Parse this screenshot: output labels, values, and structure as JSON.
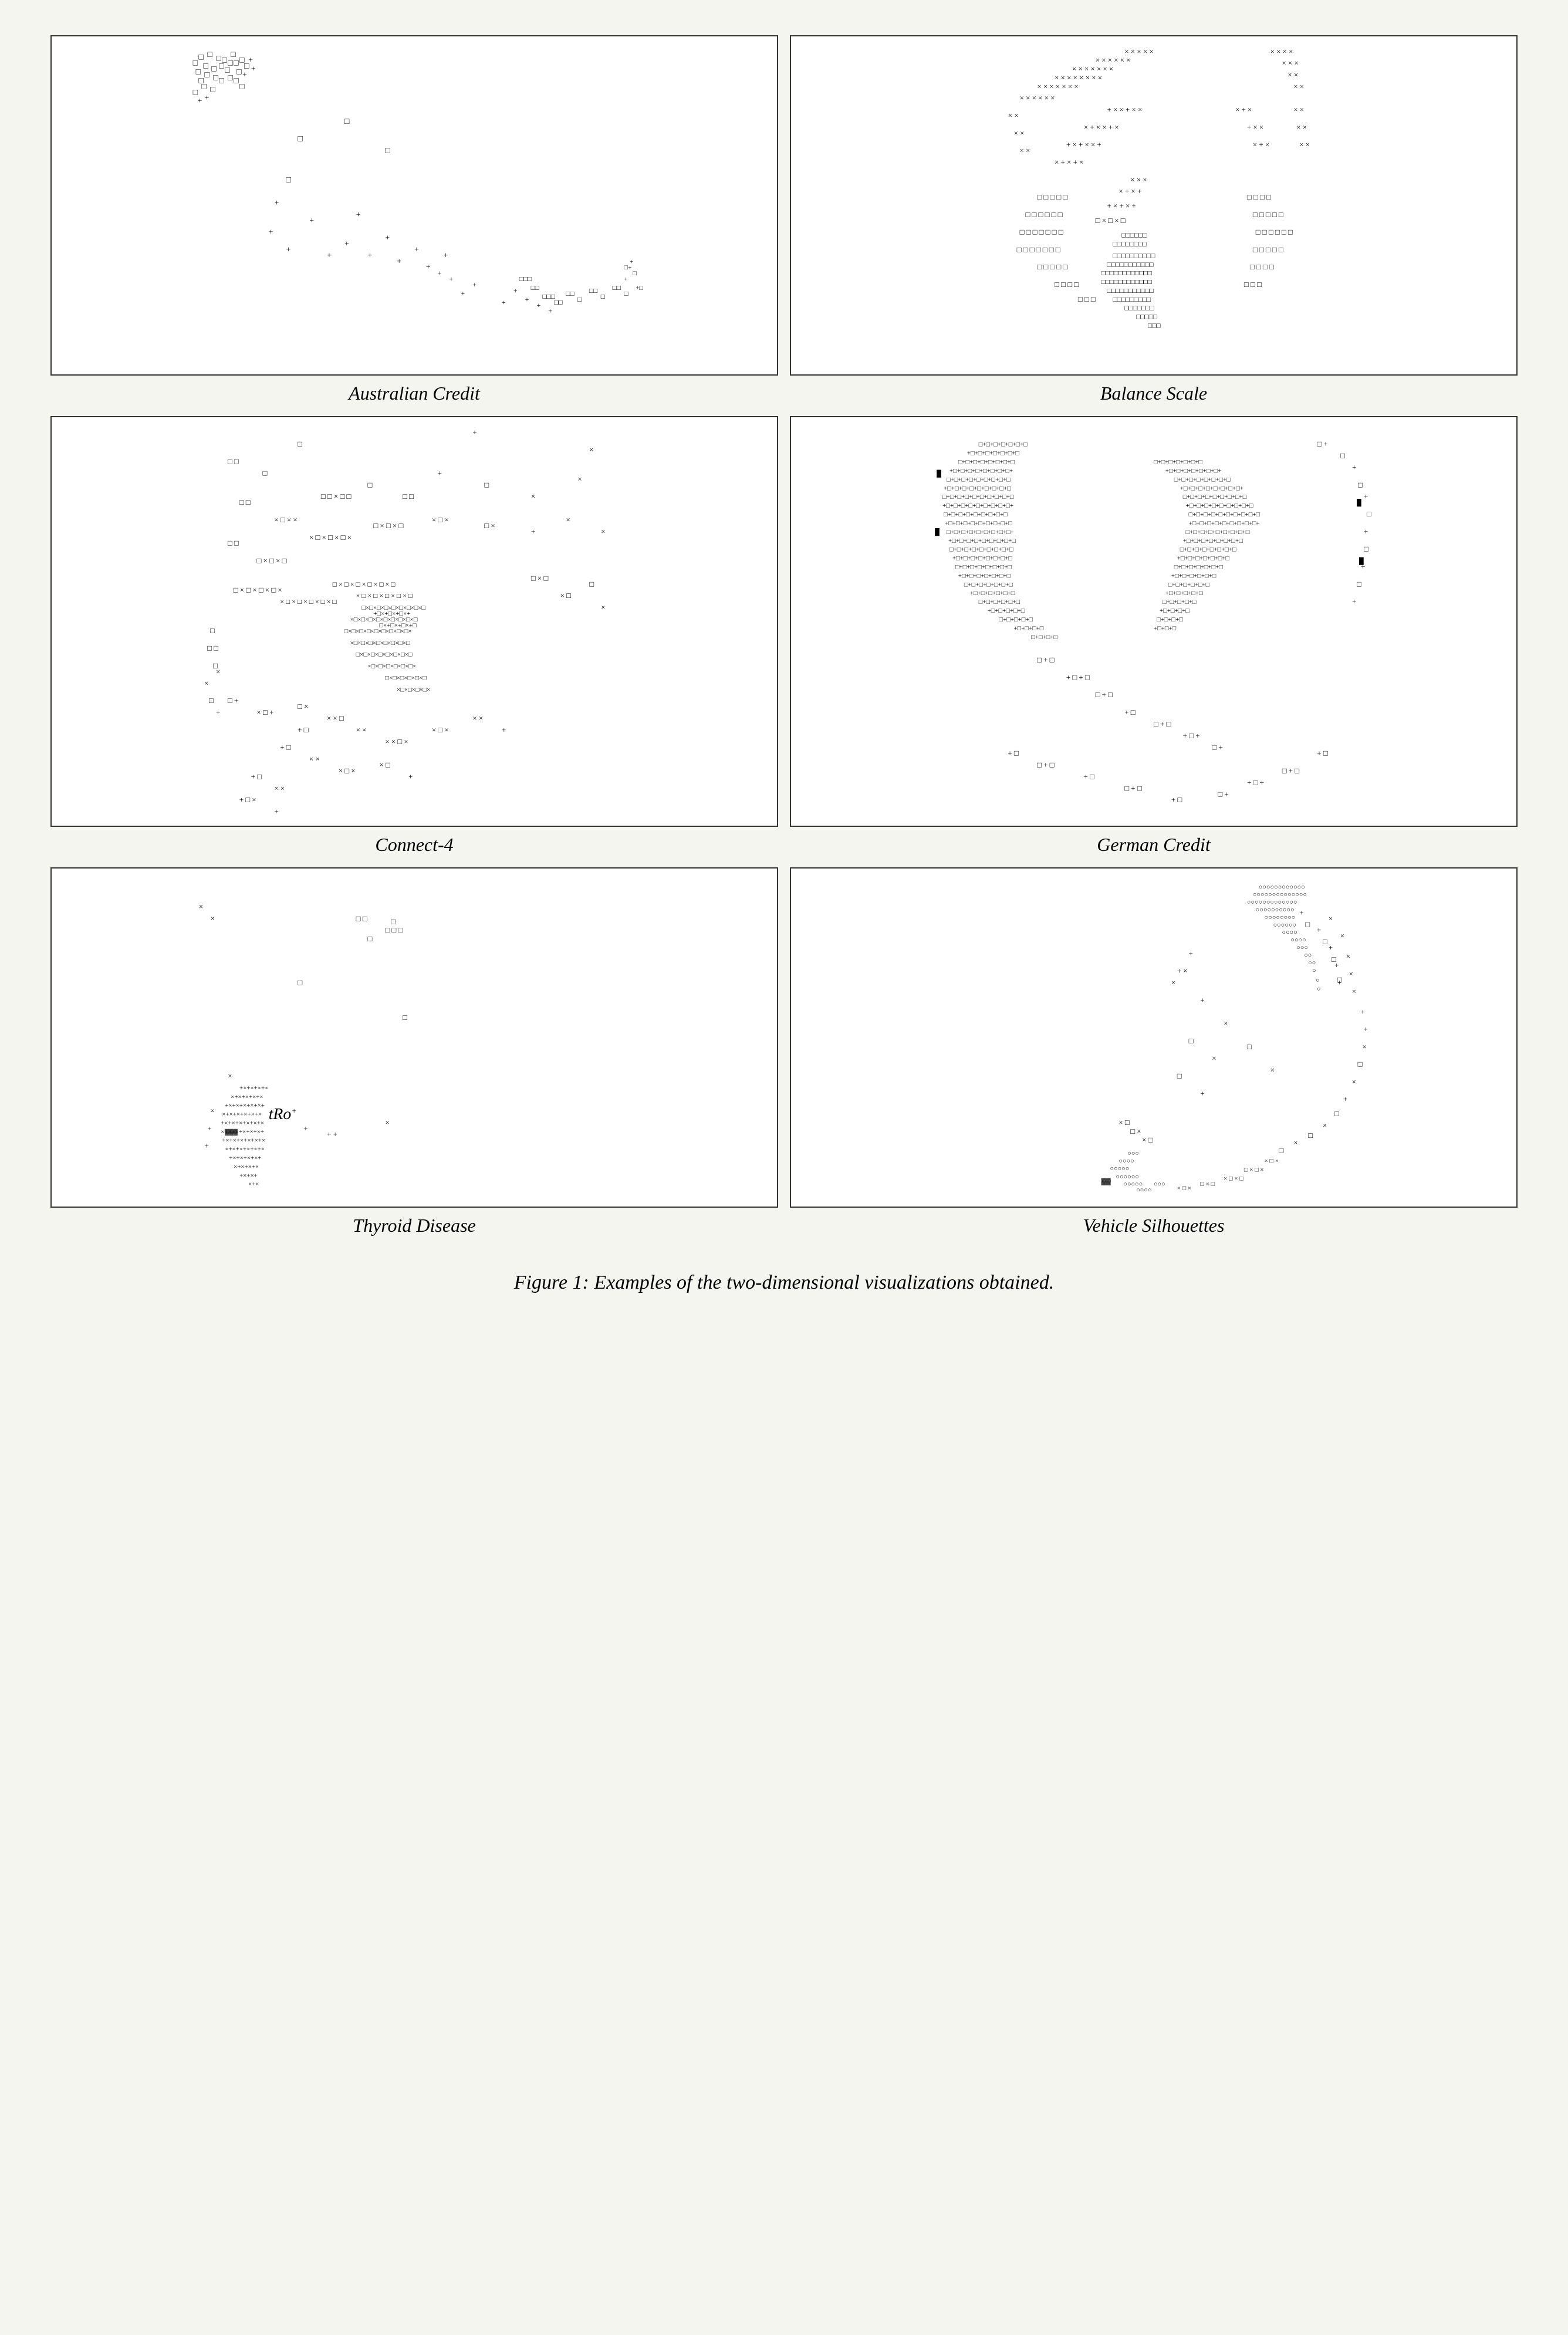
{
  "charts": [
    {
      "id": "australian-credit",
      "label": "Australian Credit",
      "description": "Scatter plot showing Australian Credit dataset with mixed clusters"
    },
    {
      "id": "balance-scale",
      "label": "Balance Scale",
      "description": "Scatter plot showing Balance Scale dataset with circular distribution"
    },
    {
      "id": "connect-4",
      "label": "Connect-4",
      "description": "Scatter plot showing Connect-4 dataset with dense center"
    },
    {
      "id": "german-credit",
      "label": "German Credit",
      "description": "Scatter plot showing German Credit dataset with yin-yang like distribution"
    },
    {
      "id": "thyroid-disease",
      "label": "Thyroid Disease",
      "description": "Scatter plot showing Thyroid Disease dataset with cluster bottom-left"
    },
    {
      "id": "vehicle-silhouettes",
      "label": "Vehicle Silhouettes",
      "description": "Scatter plot showing Vehicle Silhouettes dataset with arc distribution"
    }
  ],
  "caption": "Figure 1: Examples of the two-dimensional visualizations obtained."
}
